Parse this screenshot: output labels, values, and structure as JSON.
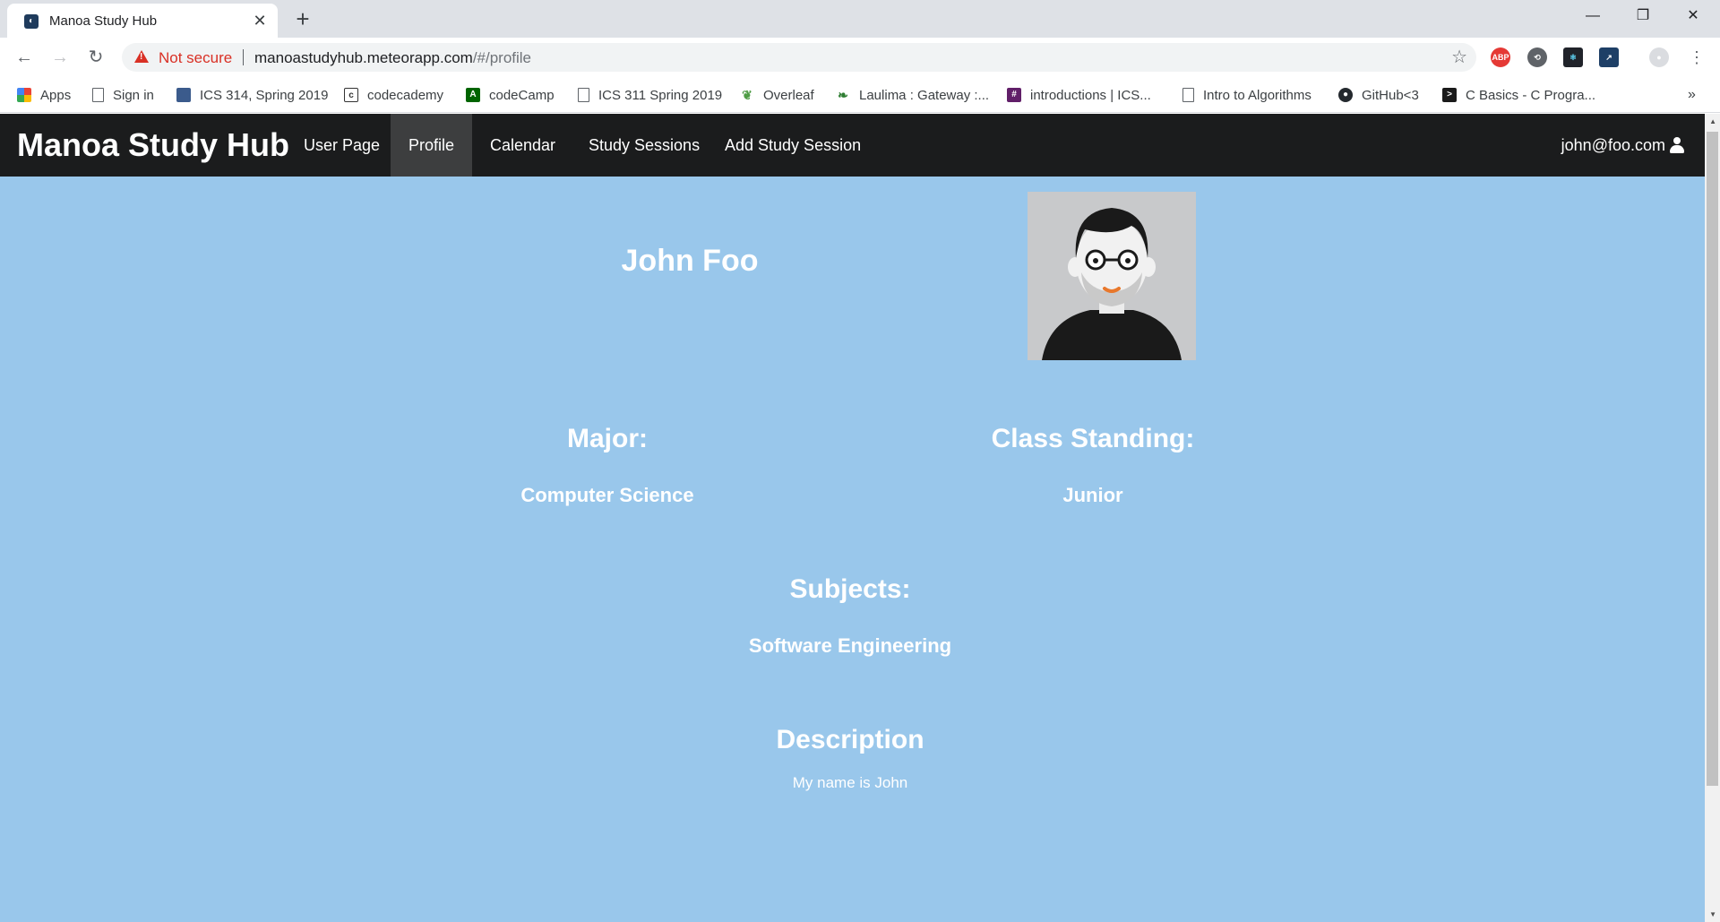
{
  "browser": {
    "tab_title": "Manoa Study Hub",
    "security_label": "Not secure",
    "url_host": "manoastudyhub.meteorapp.com",
    "url_path": "/#/profile",
    "bookmarks": [
      "Apps",
      "Sign in",
      "ICS 314, Spring 2019",
      "codecademy",
      "codeCamp",
      "ICS 311 Spring 2019",
      "Overleaf",
      "Laulima : Gateway :...",
      "introductions | ICS...",
      "Intro to Algorithms",
      "GitHub<3",
      "C Basics - C Progra..."
    ],
    "extensions": [
      "ABP"
    ]
  },
  "navbar": {
    "brand": "Manoa Study Hub",
    "items": [
      "User Page",
      "Profile",
      "Calendar",
      "Study Sessions",
      "Add Study Session"
    ],
    "active_item": "Profile",
    "user_email": "john@foo.com"
  },
  "profile": {
    "name": "John Foo",
    "major_label": "Major:",
    "major": "Computer Science",
    "standing_label": "Class Standing:",
    "standing": "Junior",
    "subjects_label": "Subjects:",
    "subjects": "Software Engineering",
    "description_label": "Description",
    "description": "My name is John"
  },
  "colors": {
    "page_background": "#99c7eb",
    "navbar_background": "#1b1c1d",
    "active_nav_background": "#3d3e3f",
    "warning": "#d93025"
  }
}
